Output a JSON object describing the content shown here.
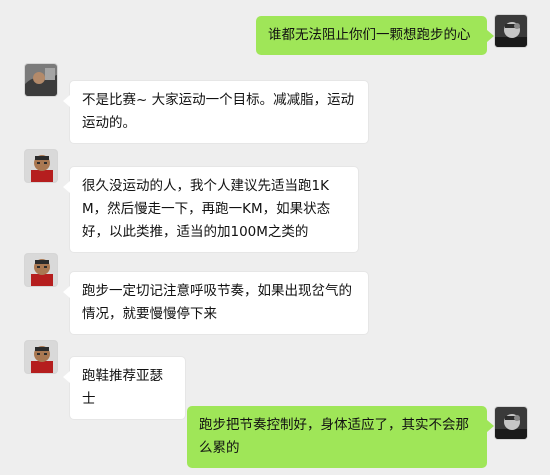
{
  "colors": {
    "background": "#eeeeee",
    "incoming_bubble": "#ffffff",
    "outgoing_bubble": "#9fe658",
    "text": "#111111"
  },
  "messages": [
    {
      "direction": "outgoing",
      "text": "谁都无法阻止你们一颗想跑步的心",
      "avatar": "user-avatar"
    },
    {
      "direction": "incoming",
      "text": "不是比赛~ 大家运动一个目标。减减脂，运动运动的。",
      "avatar": "contact-avatar-1"
    },
    {
      "direction": "incoming",
      "text": "很久没运动的人，我个人建议先适当跑1KM，然后慢走一下，再跑一KM，如果状态好，以此类推，适当的加100M之类的",
      "avatar": "contact-avatar-2"
    },
    {
      "direction": "incoming",
      "text": "跑步一定切记注意呼吸节奏，如果出现岔气的情况，就要慢慢停下来",
      "avatar": "contact-avatar-2"
    },
    {
      "direction": "incoming",
      "text": "跑鞋推荐亚瑟士",
      "avatar": "contact-avatar-2"
    },
    {
      "direction": "outgoing",
      "text": "跑步把节奏控制好，身体适应了，其实不会那么累的",
      "avatar": "user-avatar"
    }
  ]
}
